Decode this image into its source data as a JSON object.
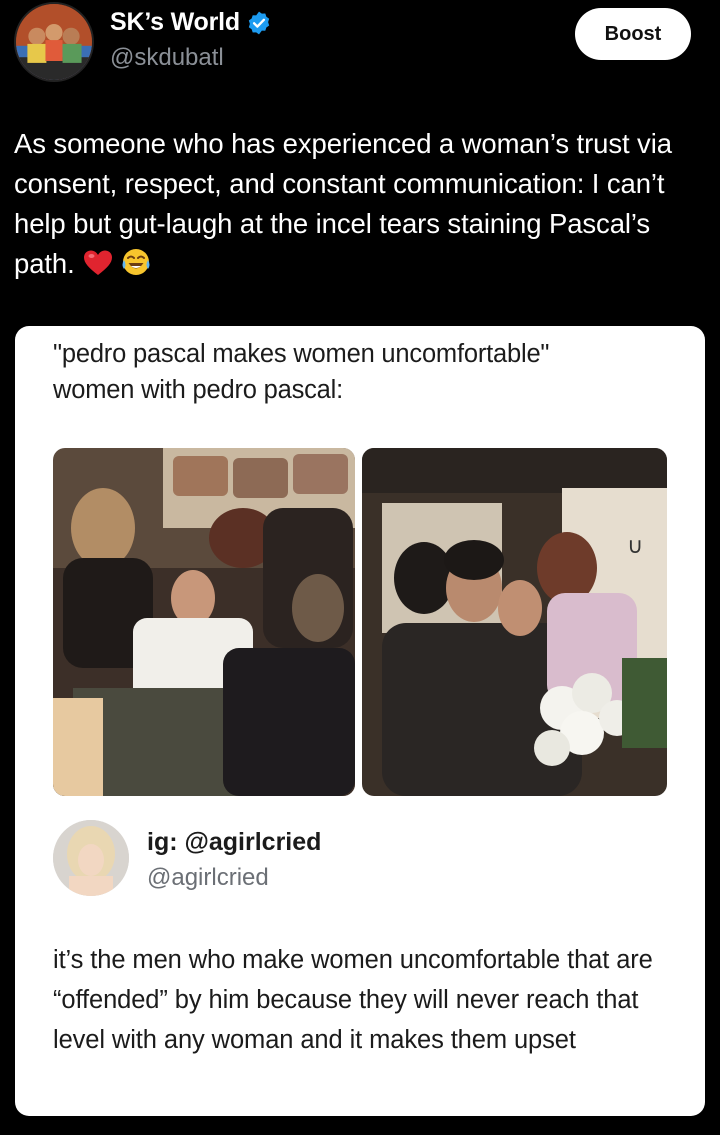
{
  "header": {
    "display_name": "SK’s World",
    "handle": "@skdubatl",
    "boost_label": "Boost",
    "avatar_icon": "profile-avatar",
    "verified_icon": "verified-badge-icon"
  },
  "post": {
    "text": "As someone who has experienced a woman’s trust via consent, respect, and constant communication: I can’t help but gut-laugh at the incel tears staining Pascal’s path.",
    "emojis": [
      "red-heart-emoji",
      "tears-of-joy-emoji"
    ]
  },
  "embedded_image": {
    "caption_line1": "\"pedro pascal makes women uncomfortable\"",
    "caption_line2": "women with pedro pascal:",
    "photos": [
      "photo-group-on-couch",
      "photo-group-hug-with-flowers"
    ],
    "quoted": {
      "name": "ig: @agirlcried",
      "handle": "@agirlcried",
      "text": "it’s the men who make women uncomfortable that are “offended” by him because they will never reach that level with any woman and it makes them upset"
    }
  },
  "colors": {
    "background": "#000000",
    "primary_text": "#ffffff",
    "secondary_text": "#8b9097",
    "verified_blue": "#1d9bf0",
    "card_background": "#ffffff",
    "card_text": "#1b1b1b"
  }
}
